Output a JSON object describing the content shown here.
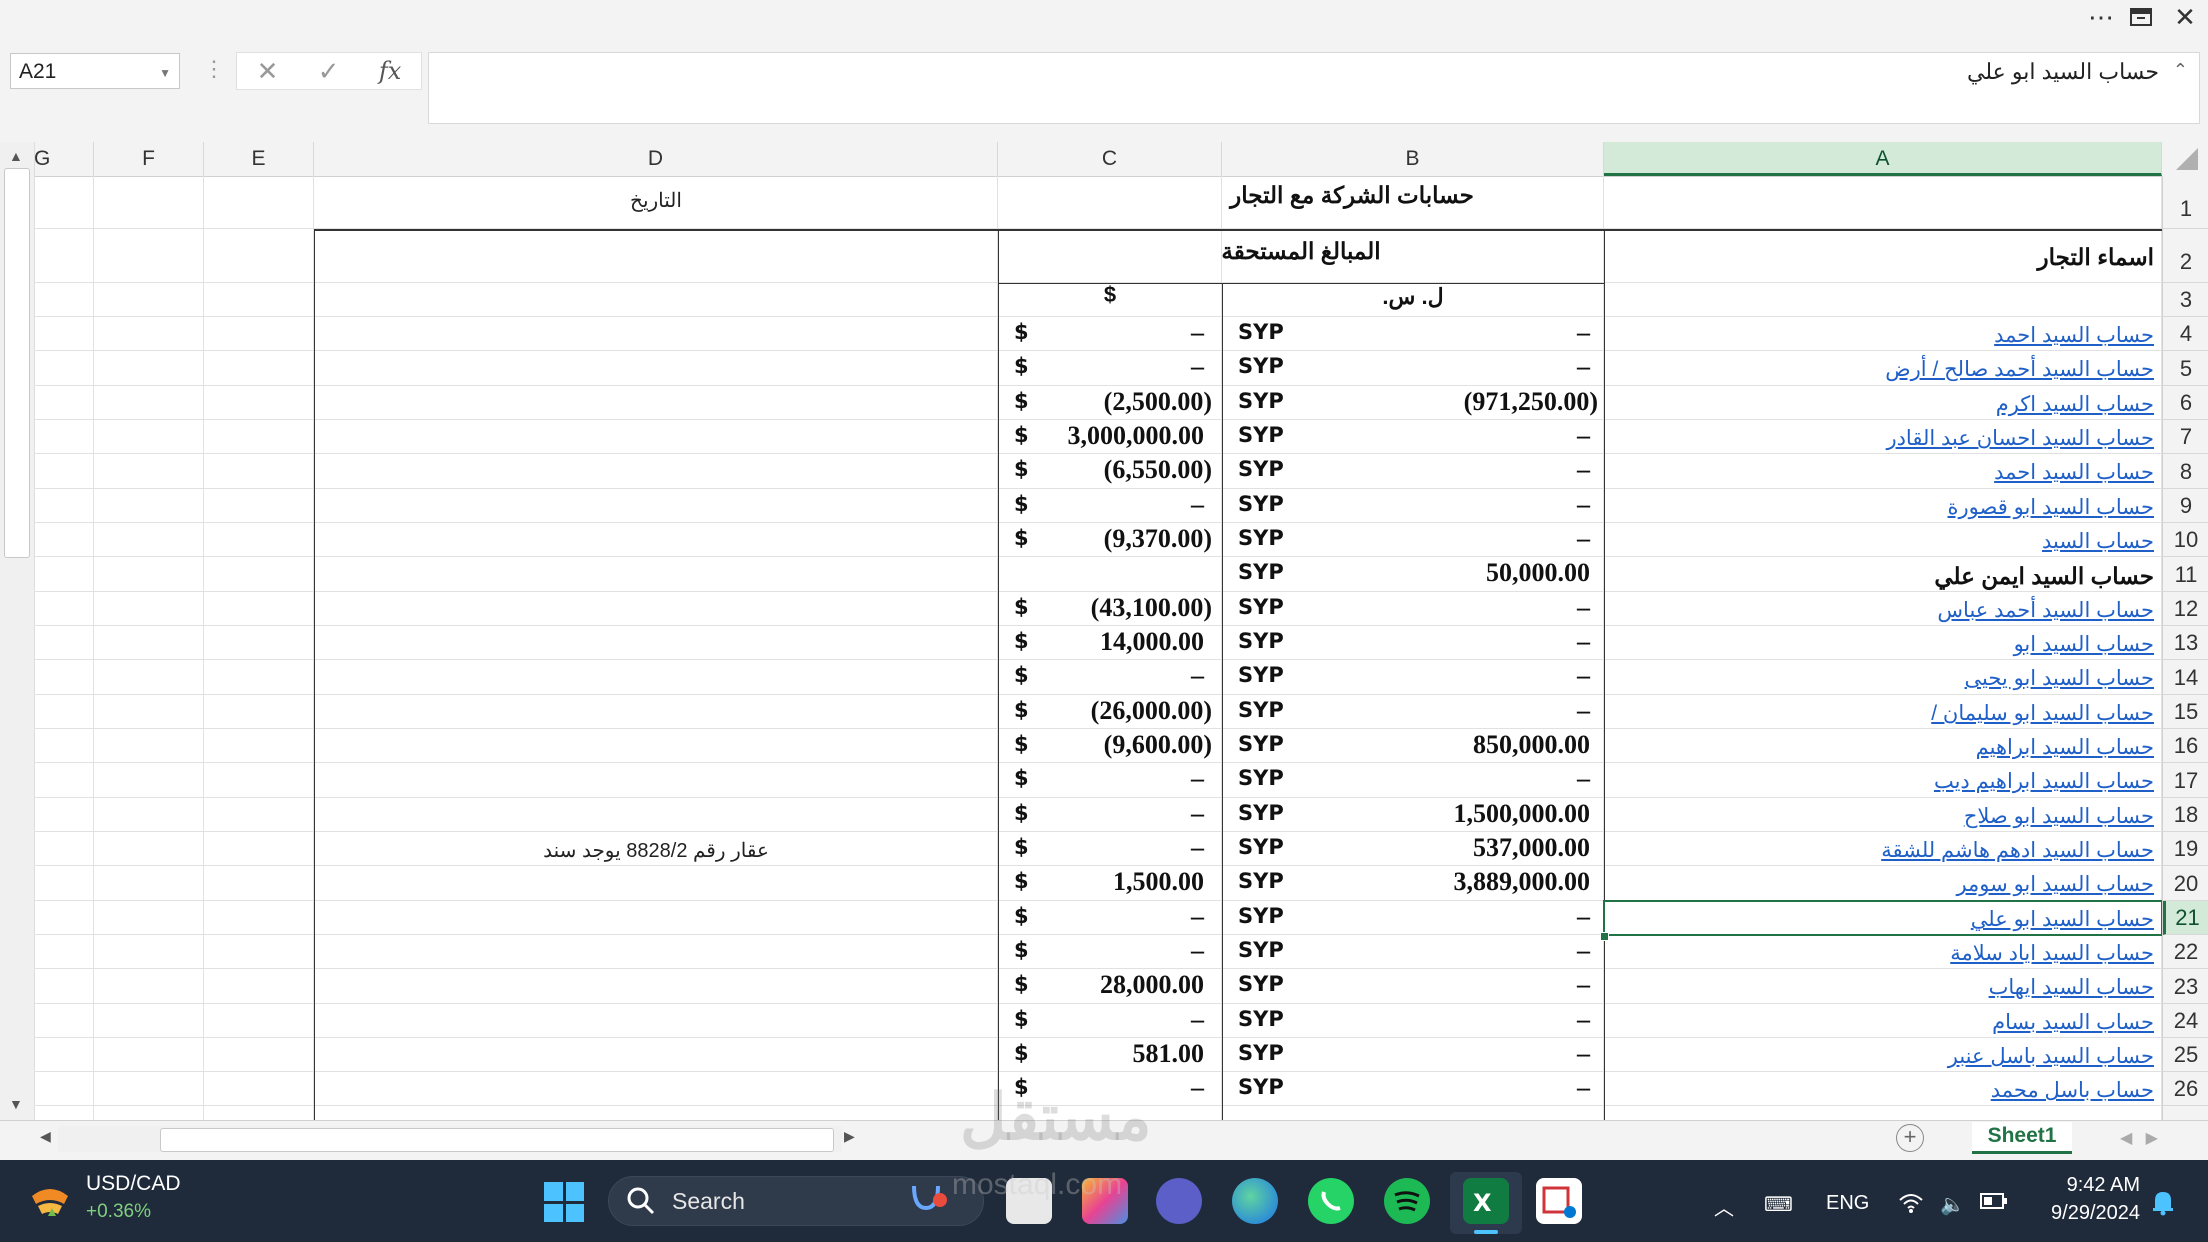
{
  "window": {
    "more_icon": "more-dots-icon",
    "restore_icon": "restore-window-icon",
    "close_icon": "close-icon"
  },
  "formula_bar": {
    "name_box": "A21",
    "formula": "حساب السيد ابو علي",
    "fx_label": "fx"
  },
  "columns": [
    "G",
    "F",
    "E",
    "D",
    "C",
    "B",
    "A"
  ],
  "rows": [
    "1",
    "2",
    "3",
    "4",
    "5",
    "6",
    "7",
    "8",
    "9",
    "10",
    "11",
    "12",
    "13",
    "14",
    "15",
    "16",
    "17",
    "18",
    "19",
    "20",
    "21",
    "22",
    "23",
    "24",
    "25",
    "26"
  ],
  "selected_cell": {
    "column": "A",
    "row": "21"
  },
  "sheet": {
    "title": "حسابات الشركة مع التجار",
    "date_label": "التاريخ",
    "names_header": "اسماء التجار",
    "amounts_header": "المبالغ المستحقة",
    "syp_header": "ل. س.",
    "usd_header": "$",
    "syp_code": "SYP",
    "usd_symbol": "$",
    "dash": "–",
    "entries": [
      {
        "name": "حساب السيد احمد",
        "syp": "–",
        "usd": "–",
        "link": true,
        "note": ""
      },
      {
        "name": "حساب السيد أحمد صالح / أرض",
        "syp": "–",
        "usd": "–",
        "link": true,
        "note": ""
      },
      {
        "name": "حساب السيد اكرم",
        "syp": "(971,250.00)",
        "usd": "(2,500.00)",
        "link": true,
        "note": ""
      },
      {
        "name": "حساب السيد احسان عبد القادر",
        "syp": "–",
        "usd": "3,000,000.00",
        "link": true,
        "note": ""
      },
      {
        "name": "حساب السيد احمد",
        "syp": "–",
        "usd": "(6,550.00)",
        "link": true,
        "note": ""
      },
      {
        "name": "حساب السيد ابو قصورة",
        "syp": "–",
        "usd": "–",
        "link": true,
        "note": ""
      },
      {
        "name": "حساب السيد",
        "syp": "–",
        "usd": "(9,370.00)",
        "link": true,
        "note": ""
      },
      {
        "name": "حساب السيد ايمن علي",
        "syp": "50,000.00",
        "usd": "",
        "link": false,
        "note": ""
      },
      {
        "name": "حساب السيد أحمد عباس",
        "syp": "–",
        "usd": "(43,100.00)",
        "link": true,
        "note": ""
      },
      {
        "name": "حساب السيد ابو",
        "syp": "–",
        "usd": "14,000.00",
        "link": true,
        "note": ""
      },
      {
        "name": "حساب السيد ابو يحيى",
        "syp": "–",
        "usd": "–",
        "link": true,
        "note": ""
      },
      {
        "name": "حساب السيد ابو سليمان /",
        "syp": "–",
        "usd": "(26,000.00)",
        "link": true,
        "note": ""
      },
      {
        "name": "حساب السيد ابراهيم",
        "syp": "850,000.00",
        "usd": "(9,600.00)",
        "link": true,
        "note": ""
      },
      {
        "name": "حساب السيد ابراهيم ديب",
        "syp": "–",
        "usd": "–",
        "link": true,
        "note": ""
      },
      {
        "name": "حساب السيد ابو صلاح",
        "syp": "1,500,000.00",
        "usd": "–",
        "link": true,
        "note": ""
      },
      {
        "name": "حساب السيد ادهم هاشم للشقة",
        "syp": "537,000.00",
        "usd": "–",
        "link": true,
        "note": "عقار رقم 8828/2 يوجد سند"
      },
      {
        "name": "حساب السيد ابو سومر",
        "syp": "3,889,000.00",
        "usd": "1,500.00",
        "link": true,
        "note": ""
      },
      {
        "name": "حساب السيد ابو علي",
        "syp": "–",
        "usd": "–",
        "link": true,
        "note": ""
      },
      {
        "name": "حساب السيد اياد سلامة",
        "syp": "–",
        "usd": "–",
        "link": true,
        "note": ""
      },
      {
        "name": "حساب السيد ايهاب",
        "syp": "–",
        "usd": "28,000.00",
        "link": true,
        "note": ""
      },
      {
        "name": "حساب السيد بسام",
        "syp": "–",
        "usd": "–",
        "link": true,
        "note": ""
      },
      {
        "name": "حساب السيد باسل عنبر",
        "syp": "–",
        "usd": "581.00",
        "link": true,
        "note": ""
      },
      {
        "name": "حساب باسل محمد",
        "syp": "–",
        "usd": "–",
        "link": true,
        "note": ""
      }
    ]
  },
  "tabs": {
    "sheet_name": "Sheet1",
    "add_sheet": "+"
  },
  "taskbar": {
    "stock_name": "USD/CAD",
    "stock_change": "+0.36%",
    "search_label": "Search",
    "language": "ENG",
    "time": "9:42 AM",
    "date": "9/29/2024",
    "accent": "#4cc2ff"
  },
  "watermark": {
    "text": "مستقل",
    "url": "mostaql.com"
  }
}
